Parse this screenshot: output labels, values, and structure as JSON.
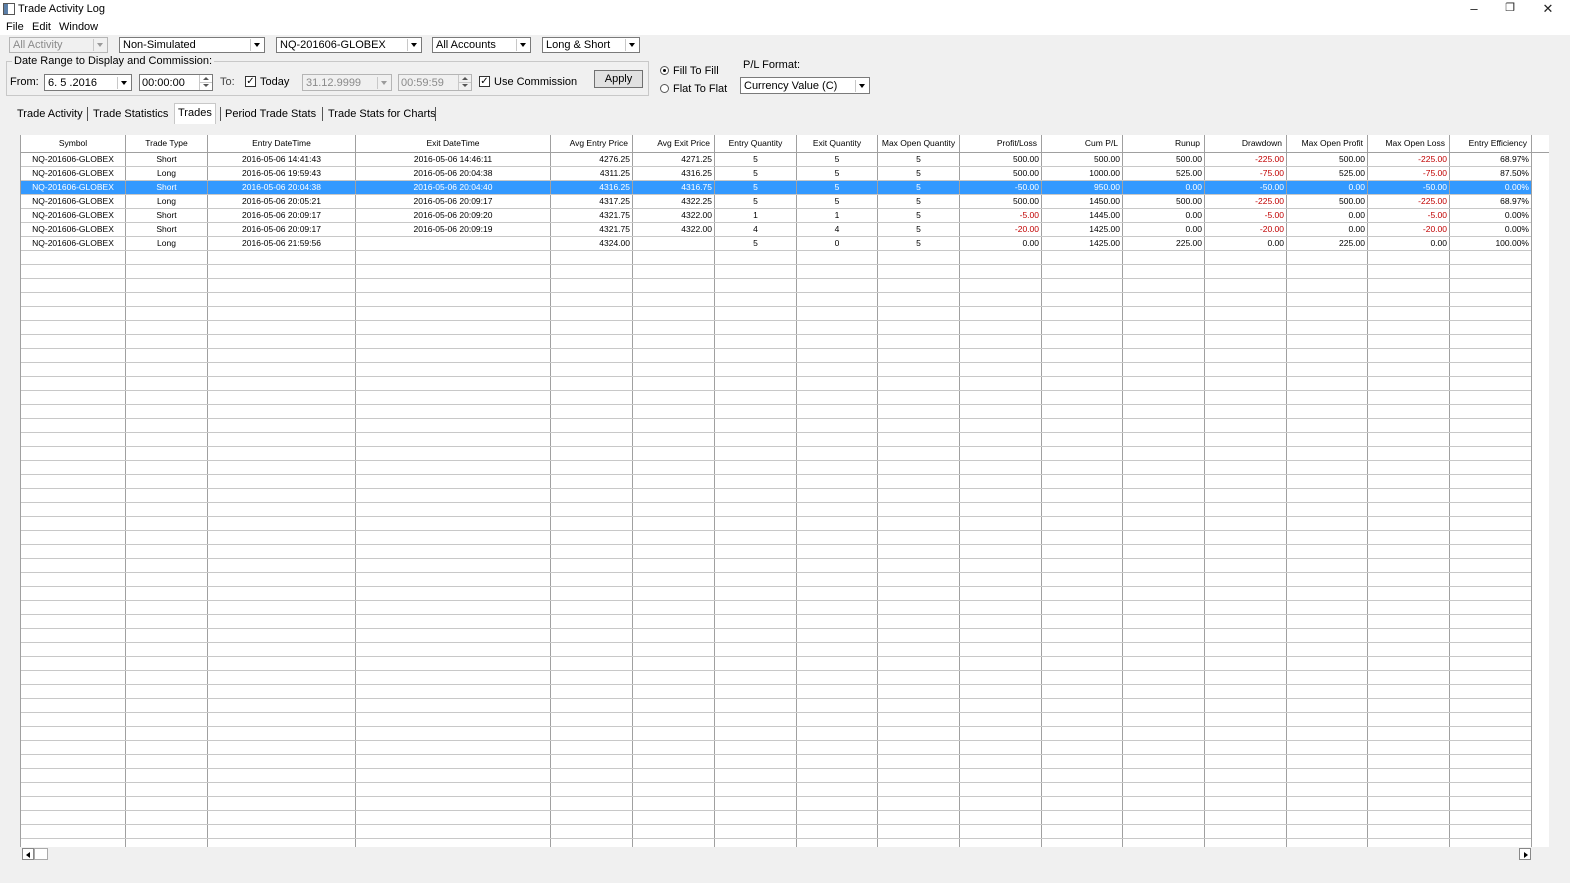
{
  "window": {
    "title": "Trade Activity Log",
    "minimize": "–",
    "restore": "❐",
    "close": "✕"
  },
  "menu": [
    "File",
    "Edit",
    "Window"
  ],
  "filters": {
    "activity": "All Activity",
    "simulation": "Non-Simulated",
    "symbol": "NQ-201606-GLOBEX",
    "accounts": "All Accounts",
    "side": "Long & Short"
  },
  "date_range": {
    "legend": "Date Range to Display and Commission:",
    "from_label": "From:",
    "from_date": "6. 5 .2016",
    "from_time": "00:00:00",
    "to_label": "To:",
    "today_label": "Today",
    "to_date": "31.12.9999",
    "to_time": "00:59:59",
    "use_commission_label": "Use Commission",
    "apply_label": "Apply"
  },
  "fill_options": {
    "fill_to_fill": "Fill To Fill",
    "flat_to_flat": "Flat To Flat"
  },
  "pl_format": {
    "label": "P/L Format:",
    "value": "Currency Value (C)"
  },
  "tabs": [
    "Trade Activity",
    "Trade Statistics",
    "Trades",
    "Period Trade Stats",
    "Trade Stats for Charts"
  ],
  "active_tab": "Trades",
  "columns": [
    "Symbol",
    "Trade Type",
    "Entry DateTime",
    "Exit DateTime",
    "Avg Entry Price",
    "Avg Exit Price",
    "Entry Quantity",
    "Exit Quantity",
    "Max Open Quantity",
    "Profit/Loss",
    "Cum P/L",
    "Runup",
    "Drawdown",
    "Max Open Profit",
    "Max Open Loss",
    "Entry Efficiency"
  ],
  "rows": [
    [
      "NQ-201606-GLOBEX",
      "Short",
      "2016-05-06  14:41:43",
      "2016-05-06  14:46:11",
      "4276.25",
      "4271.25",
      "5",
      "5",
      "5",
      "500.00",
      "500.00",
      "500.00",
      "-225.00",
      "500.00",
      "-225.00",
      "68.97%"
    ],
    [
      "NQ-201606-GLOBEX",
      "Long",
      "2016-05-06  19:59:43",
      "2016-05-06  20:04:38",
      "4311.25",
      "4316.25",
      "5",
      "5",
      "5",
      "500.00",
      "1000.00",
      "525.00",
      "-75.00",
      "525.00",
      "-75.00",
      "87.50%"
    ],
    [
      "NQ-201606-GLOBEX",
      "Short",
      "2016-05-06  20:04:38",
      "2016-05-06  20:04:40",
      "4316.25",
      "4316.75",
      "5",
      "5",
      "5",
      "-50.00",
      "950.00",
      "0.00",
      "-50.00",
      "0.00",
      "-50.00",
      "0.00%"
    ],
    [
      "NQ-201606-GLOBEX",
      "Long",
      "2016-05-06  20:05:21",
      "2016-05-06  20:09:17",
      "4317.25",
      "4322.25",
      "5",
      "5",
      "5",
      "500.00",
      "1450.00",
      "500.00",
      "-225.00",
      "500.00",
      "-225.00",
      "68.97%"
    ],
    [
      "NQ-201606-GLOBEX",
      "Short",
      "2016-05-06  20:09:17",
      "2016-05-06  20:09:20",
      "4321.75",
      "4322.00",
      "1",
      "1",
      "5",
      "-5.00",
      "1445.00",
      "0.00",
      "-5.00",
      "0.00",
      "-5.00",
      "0.00%"
    ],
    [
      "NQ-201606-GLOBEX",
      "Short",
      "2016-05-06  20:09:17",
      "2016-05-06  20:09:19",
      "4321.75",
      "4322.00",
      "4",
      "4",
      "5",
      "-20.00",
      "1425.00",
      "0.00",
      "-20.00",
      "0.00",
      "-20.00",
      "0.00%"
    ],
    [
      "NQ-201606-GLOBEX",
      "Long",
      "2016-05-06  21:59:56",
      "",
      "4324.00",
      "",
      "5",
      "0",
      "5",
      "0.00",
      "1425.00",
      "225.00",
      "0.00",
      "225.00",
      "0.00",
      "100.00%"
    ]
  ],
  "selected_row": 2,
  "colors": {
    "selection": "#3399ff",
    "negative": "#c00000"
  }
}
